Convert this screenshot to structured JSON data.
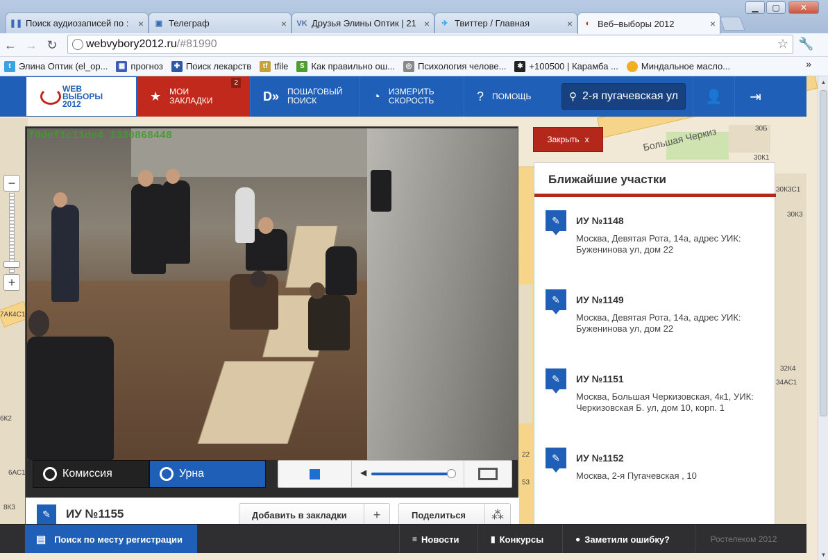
{
  "browser": {
    "tabs": [
      {
        "label": "Поиск аудиозаписей по :",
        "active": false
      },
      {
        "label": "Телеграф",
        "active": false
      },
      {
        "label": "Друзья Элины Оптик | 21",
        "active": false
      },
      {
        "label": "Твиттер / Главная",
        "active": false
      },
      {
        "label": "Веб–выборы 2012",
        "active": true
      }
    ],
    "url_host": "webvybory2012.ru",
    "url_path": "/#81990",
    "bookmarks": [
      {
        "label": "Элина Оптик (el_op...",
        "icon": "twitter-icon",
        "color": "#3aa3e3"
      },
      {
        "label": "прогноз",
        "icon": "forecast-icon",
        "color": "#3a5fb8"
      },
      {
        "label": "Поиск лекарств",
        "icon": "pill-icon",
        "color": "#2a5aa5"
      },
      {
        "label": "tfile",
        "icon": "tfile-icon",
        "color": "#c8a03a"
      },
      {
        "label": "Как правильно ош...",
        "icon": "s-icon",
        "color": "#4aa02a"
      },
      {
        "label": "Психология челове...",
        "icon": "globe-icon",
        "color": "#888888"
      },
      {
        "label": "+100500 | Карамба ...",
        "icon": "tv-icon",
        "color": "#222222"
      },
      {
        "label": "Миндальное масло...",
        "icon": "circle-icon",
        "color": "#f2b01e"
      }
    ],
    "more": "»"
  },
  "header": {
    "logo_line1": "WEB",
    "logo_line2": "ВЫБОРЫ",
    "logo_line3": "2012",
    "nav": [
      {
        "label_line1": "МОИ",
        "label_line2": "ЗАКЛАДКИ",
        "icon": "star-icon",
        "badge": "2"
      },
      {
        "label_line1": "ПОШАГОВЫЙ",
        "label_line2": "ПОИСК",
        "icon": "steps-icon"
      },
      {
        "label_line1": "ИЗМЕРИТЬ",
        "label_line2": "СКОРОСТЬ",
        "icon": "speedometer-icon"
      },
      {
        "label_line1": "ПОМОЩЬ",
        "label_line2": "",
        "icon": "help-icon"
      }
    ],
    "search_value": "2-я пугачевская ул"
  },
  "video": {
    "watermark": "f0def1c11de4 1330868448",
    "cameras": [
      {
        "label": "Комиссия",
        "active": false
      },
      {
        "label": "Урна",
        "active": true
      }
    ],
    "volume_level": 0.95
  },
  "station_info": {
    "title": "ИУ №1155",
    "bookmark_label": "Добавить в закладки",
    "share_label": "Поделиться"
  },
  "nearby": {
    "close_label": "Закрыть",
    "close_x": "x",
    "title": "Ближайшие участки",
    "items": [
      {
        "name": "ИУ №1148",
        "address": "Москва, Девятая Рота, 14а, адрес УИК: Буженинова ул, дом 22"
      },
      {
        "name": "ИУ №1149",
        "address": "Москва, Девятая Рота, 14а, адрес УИК: Буженинова ул, дом 22"
      },
      {
        "name": "ИУ №1151",
        "address": "Москва, Большая Черкизовская, 4к1, УИК: Черкизовская Б. ул, дом 10, корп. 1"
      },
      {
        "name": "ИУ №1152",
        "address": "Москва, 2-я Пугачевская , 10"
      }
    ]
  },
  "map": {
    "street": "Большая Черкиз",
    "labels": [
      "30Б",
      "30К1",
      "30К3С1",
      "30К3",
      "32К4",
      "34АС1",
      "7АК4С1",
      "6К2",
      "6АС1",
      "8К3",
      "22",
      "53"
    ]
  },
  "footer": {
    "search_label": "Поиск по месту регистрации",
    "links": [
      {
        "label": "Новости",
        "icon": "news-icon"
      },
      {
        "label": "Конкурсы",
        "icon": "chart-icon"
      },
      {
        "label": "Заметили ошибку?",
        "icon": "chat-icon"
      }
    ],
    "copyright": "Ростелеком 2012"
  },
  "colors": {
    "brand_blue": "#1f5fb7",
    "brand_red": "#c0291b",
    "footer_dark": "#2f2f31"
  }
}
